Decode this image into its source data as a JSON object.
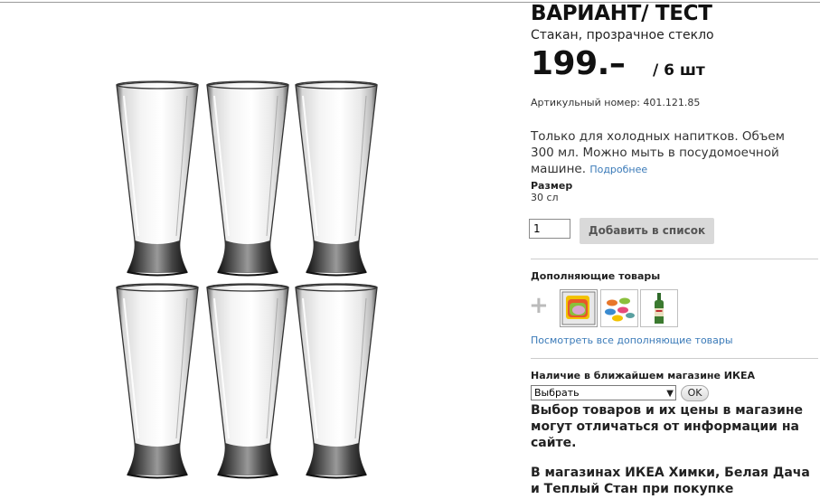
{
  "product": {
    "name": "ВАРИАНТ/ ТЕСТ",
    "type": "Стакан, прозрачное стекло",
    "price": "199.–",
    "price_unit": "/ 6 шт",
    "article": "Артикульный номер: 401.121.85",
    "description": "Только для холодных напитков. Объем 300 мл. Можно мыть в посудомоечной машине.",
    "more_link": "Подробнее",
    "size_label": "Размер",
    "size_value": "30 cл"
  },
  "cart": {
    "quantity": "1",
    "add_button": "Добавить в список"
  },
  "related": {
    "title": "Дополняющие товары",
    "see_all": "Посмотреть все дополняющие товары",
    "thumbnails": [
      "colorful-dishes-thumbnail",
      "coasters-thumbnail",
      "bottle-thumbnail"
    ]
  },
  "store": {
    "title": "Наличие в ближайшем магазине ИКЕА",
    "select_value": "Выбрать",
    "ok_button": "OK",
    "notice": "Выбор товаров и их цены в магазине могут отличаться от информации на сайте.",
    "notice2": "В магазинах ИКЕА Химки, Белая Дача и Теплый Стан при покупке"
  },
  "colors": {
    "link": "#3a7ab8",
    "button_bg": "#d9d9d9",
    "text": "#333333"
  }
}
